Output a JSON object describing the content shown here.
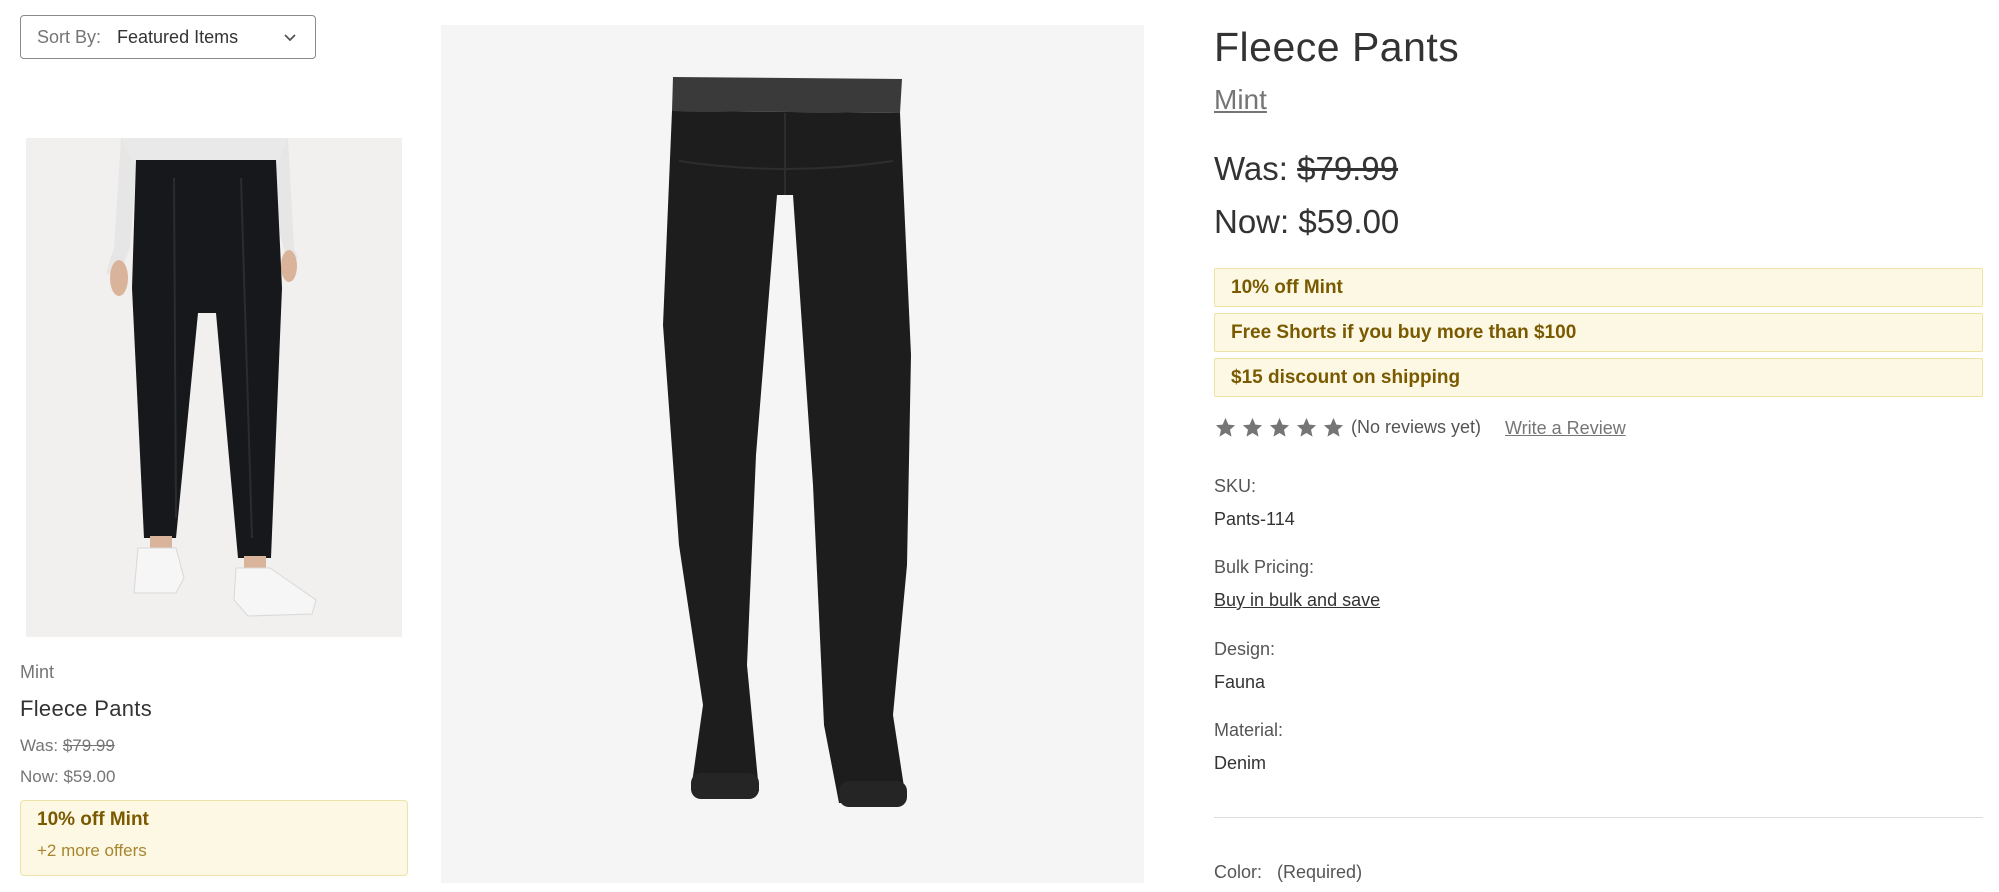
{
  "sort": {
    "label": "Sort By:",
    "value": "Featured Items"
  },
  "card": {
    "brand": "Mint",
    "name": "Fleece Pants",
    "was_label": "Was:",
    "was_price": "$79.99",
    "now": "Now: $59.00",
    "promo_title": "10% off Mint",
    "promo_more": "+2 more offers"
  },
  "product": {
    "title": "Fleece Pants",
    "brand": "Mint",
    "was_label": "Was:",
    "was_price": "$79.99",
    "now_price": "Now: $59.00",
    "promotions": [
      "10% off Mint",
      "Free Shorts if you buy more than $100",
      "$15 discount on shipping"
    ],
    "rating_stars": 5,
    "reviews_text": "(No reviews yet)",
    "write_review": "Write a Review",
    "sku_label": "SKU:",
    "sku_value": "Pants-114",
    "bulk_label": "Bulk Pricing:",
    "bulk_link": "Buy in bulk and save",
    "design_label": "Design:",
    "design_value": "Fauna",
    "material_label": "Material:",
    "material_value": "Denim",
    "color_label": "Color:",
    "color_required": "(Required)"
  },
  "colors": {
    "promo_bg": "#fdf8e4",
    "promo_text": "#7a5a00",
    "star": "#757575"
  }
}
